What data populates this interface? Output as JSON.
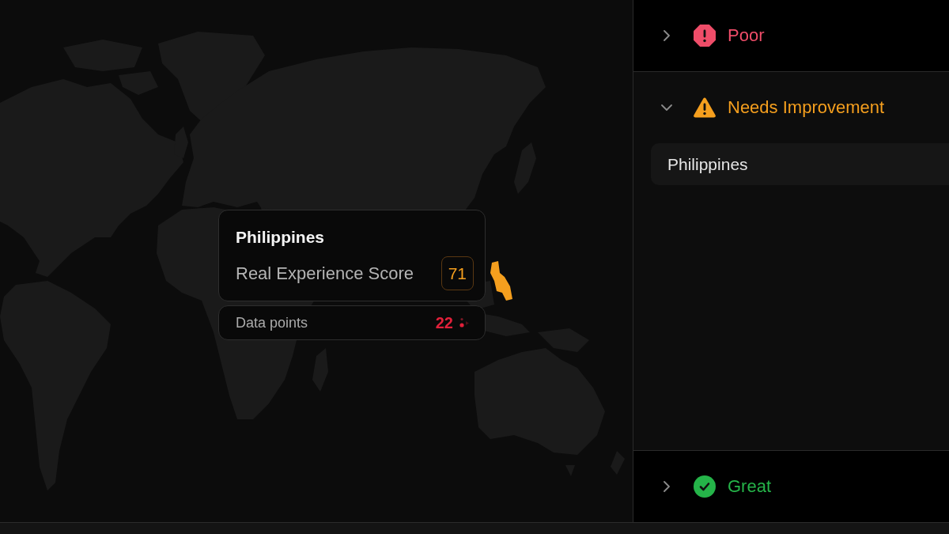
{
  "map": {
    "tooltip": {
      "title": "Philippines",
      "score_label": "Real Experience Score",
      "score": "71",
      "data_points_label": "Data points",
      "data_points": "22"
    }
  },
  "categories": [
    {
      "label": "Poor",
      "kind": "poor",
      "color": "#ef4d69",
      "expanded": false
    },
    {
      "label": "Needs Improvement",
      "kind": "warning",
      "color": "#f59f1e",
      "expanded": true,
      "items": [
        {
          "label": "Philippines"
        }
      ]
    },
    {
      "label": "Great",
      "kind": "good",
      "color": "#25b449",
      "expanded": false
    }
  ]
}
